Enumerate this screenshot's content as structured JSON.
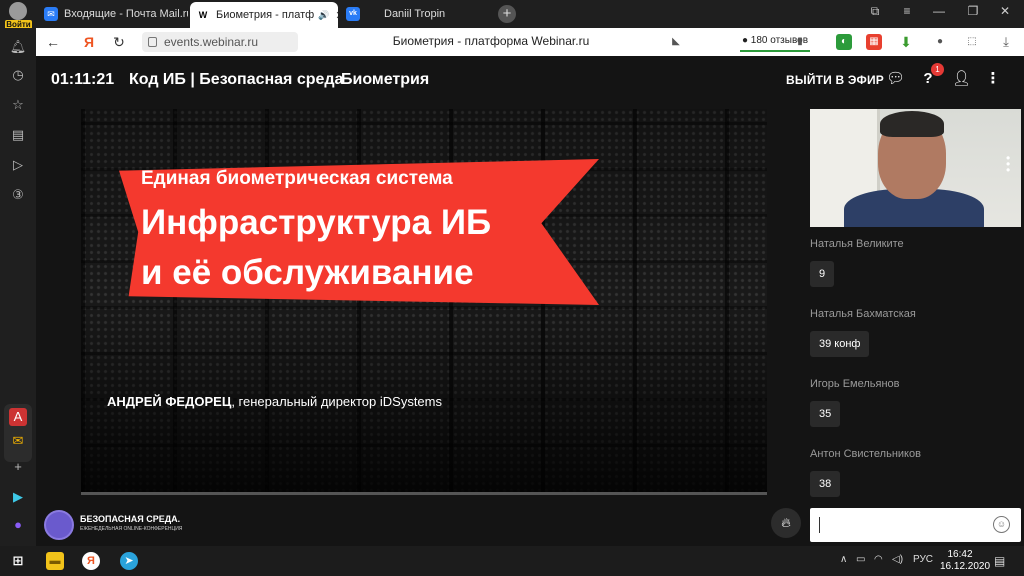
{
  "browser": {
    "profile_label": "Войти",
    "tabs": [
      {
        "label": "Входящие - Почта Mail.ru",
        "fav": "✉",
        "fav_color": "#2a7cf6"
      },
      {
        "label": "Биометрия - платф",
        "fav": "W",
        "fav_color": "#ffffff"
      },
      {
        "label": "Daniil Tropin",
        "fav": "vk",
        "fav_color": "#2a7cf6"
      }
    ],
    "new_tab": "+",
    "url": "events.webinar.ru",
    "page_title": "Биометрия - платформа Webinar.ru",
    "reviews": "180 отзывов"
  },
  "header": {
    "timer": "01:11:21",
    "event_title": "Код ИБ | Безопасная среда",
    "room_title": "Биометрия",
    "go_live": "ВЫЙТИ В ЭФИР",
    "notifications_count": "1"
  },
  "slide": {
    "subtitle": "Единая биометрическая система",
    "line1": "Инфраструктура ИБ",
    "line2": "и её обслуживание",
    "speaker_name": "АНДРЕЙ ФЕДОРЕЦ",
    "speaker_role": ", генеральный директор iDSystems"
  },
  "chat": {
    "messages": [
      {
        "author": "Наталья Великите",
        "text": "9"
      },
      {
        "author": "Наталья Бахматская",
        "text": "39 конф"
      },
      {
        "author": "Игорь Емельянов",
        "text": "35"
      },
      {
        "author": "Антон Свистельников",
        "text": "38"
      }
    ]
  },
  "brand": {
    "name": "БЕЗОПАСНАЯ СРЕДА.",
    "tagline": "ЕЖЕНЕДЕЛЬНАЯ ONLINE-КОНФЕРЕНЦИЯ"
  },
  "taskbar": {
    "lang": "РУС",
    "time": "16:42",
    "date": "16.12.2020"
  },
  "colors": {
    "banner": "#f4392e",
    "badge": "#e53935",
    "reviews_underline": "#2c9b3b"
  }
}
